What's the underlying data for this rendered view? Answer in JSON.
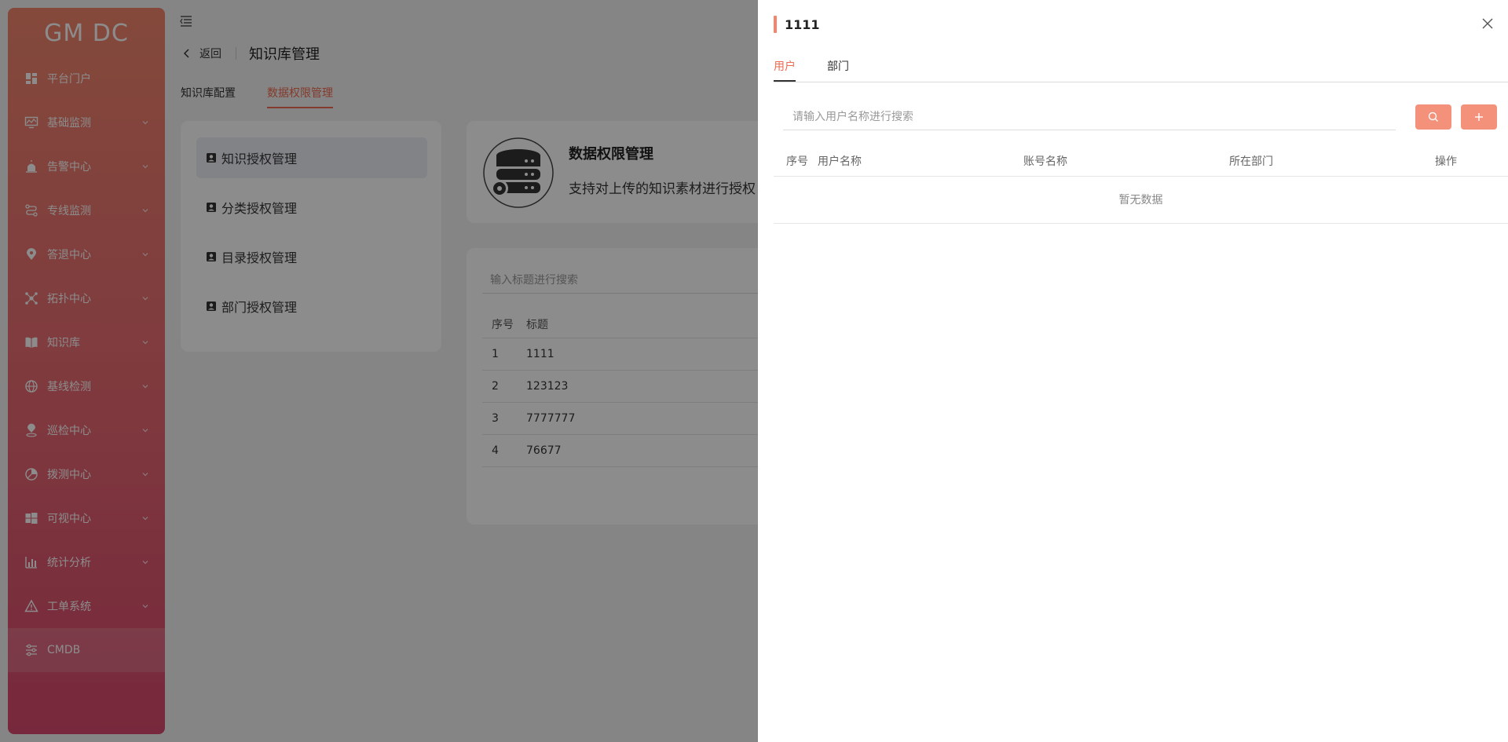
{
  "sidebar": {
    "logo": "GM DC",
    "items": [
      {
        "label": "平台门户",
        "icon": "dashboard-icon",
        "has_children": false
      },
      {
        "label": "基础监测",
        "icon": "monitor-icon",
        "has_children": true
      },
      {
        "label": "告警中心",
        "icon": "alarm-icon",
        "has_children": true
      },
      {
        "label": "专线监测",
        "icon": "route-icon",
        "has_children": true
      },
      {
        "label": "答退中心",
        "icon": "location-pin-icon",
        "has_children": true
      },
      {
        "label": "拓扑中心",
        "icon": "topology-icon",
        "has_children": true
      },
      {
        "label": "知识库",
        "icon": "book-icon",
        "has_children": true
      },
      {
        "label": "基线检测",
        "icon": "globe-icon",
        "has_children": true
      },
      {
        "label": "巡检中心",
        "icon": "map-marker-icon",
        "has_children": true
      },
      {
        "label": "拨测中心",
        "icon": "probe-icon",
        "has_children": true
      },
      {
        "label": "可视中心",
        "icon": "windows-icon",
        "has_children": true
      },
      {
        "label": "统计分析",
        "icon": "bar-chart-icon",
        "has_children": true
      },
      {
        "label": "工单系统",
        "icon": "warning-icon",
        "has_children": true
      },
      {
        "label": "CMDB",
        "icon": "sliders-icon",
        "has_children": false
      }
    ]
  },
  "header": {
    "back_label": "返回",
    "title": "知识库管理"
  },
  "tabs": [
    "知识库配置",
    "数据权限管理"
  ],
  "perm_menu": [
    "知识授权管理",
    "分类授权管理",
    "目录授权管理",
    "部门授权管理"
  ],
  "info_card": {
    "title": "数据权限管理",
    "description": "支持对上传的知识素材进行授权"
  },
  "list": {
    "search_placeholder": "输入标题进行搜索",
    "headers": [
      "序号",
      "标题"
    ],
    "rows": [
      {
        "no": "1",
        "title": "1111"
      },
      {
        "no": "2",
        "title": "123123"
      },
      {
        "no": "3",
        "title": "7777777"
      },
      {
        "no": "4",
        "title": "76677"
      }
    ]
  },
  "drawer": {
    "title": "1111",
    "tabs": [
      "用户",
      "部门"
    ],
    "search_placeholder": "请输入用户名称进行搜索",
    "headers": [
      "序号",
      "用户名称",
      "账号名称",
      "所在部门",
      "操作"
    ],
    "empty_text": "暂无数据"
  },
  "colors": {
    "accent": "#f06b50",
    "button": "#f4917a",
    "sidebar_top": "#f0866c",
    "sidebar_bottom": "#d94a6e"
  }
}
